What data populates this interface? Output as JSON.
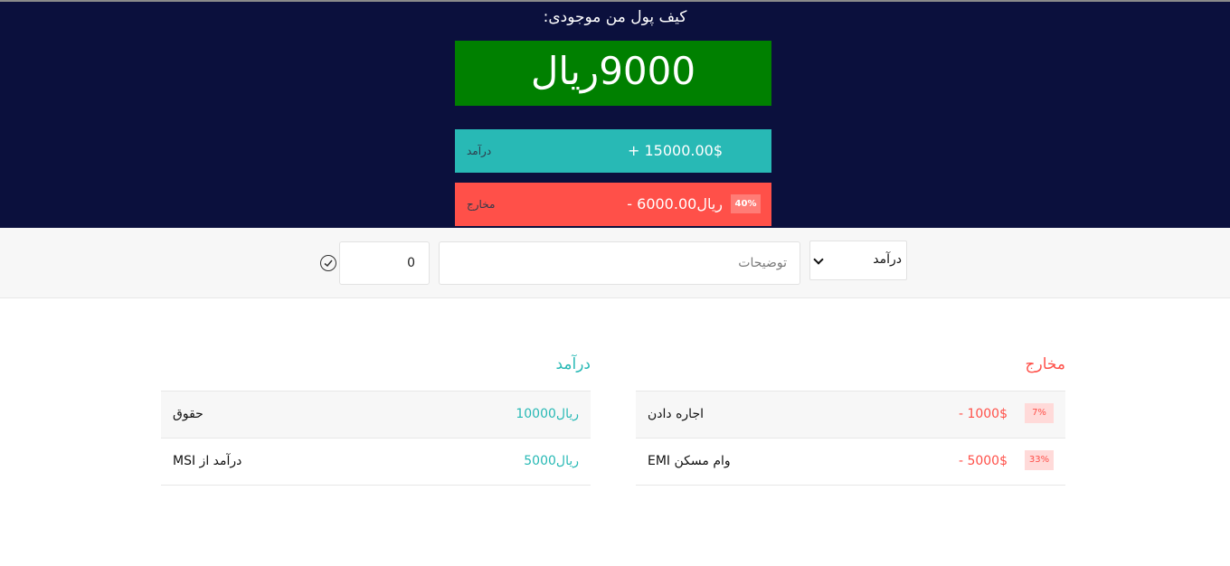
{
  "header": {
    "title": "کیف پول من موجودی:",
    "balance": "9000ریال"
  },
  "summary": {
    "income": {
      "label": "درآمد",
      "amount": "+ 15000.00$"
    },
    "expense": {
      "label": "مخارج",
      "amount": "- ریال6000.00",
      "percent": "40%"
    }
  },
  "add_form": {
    "type_selected": "درآمد",
    "description_placeholder": "توضیحات",
    "value": "0",
    "submit_icon": "check-circle-icon"
  },
  "income_list": {
    "title": "درآمد",
    "items": [
      {
        "description": "حقوق",
        "value": "10000ریال"
      },
      {
        "description": "درآمد از MSI",
        "value": "5000ریال"
      }
    ]
  },
  "expense_list": {
    "title": "مخارج",
    "items": [
      {
        "description": "اجاره دادن",
        "value": "- 1000$",
        "percent": "7%"
      },
      {
        "description": "وام مسکن EMI",
        "value": "- 5000$",
        "percent": "33%"
      }
    ]
  },
  "colors": {
    "header_bg": "#0b103d",
    "balance_bg": "#008000",
    "income": "#28b9b5",
    "expense": "#ff5049"
  }
}
